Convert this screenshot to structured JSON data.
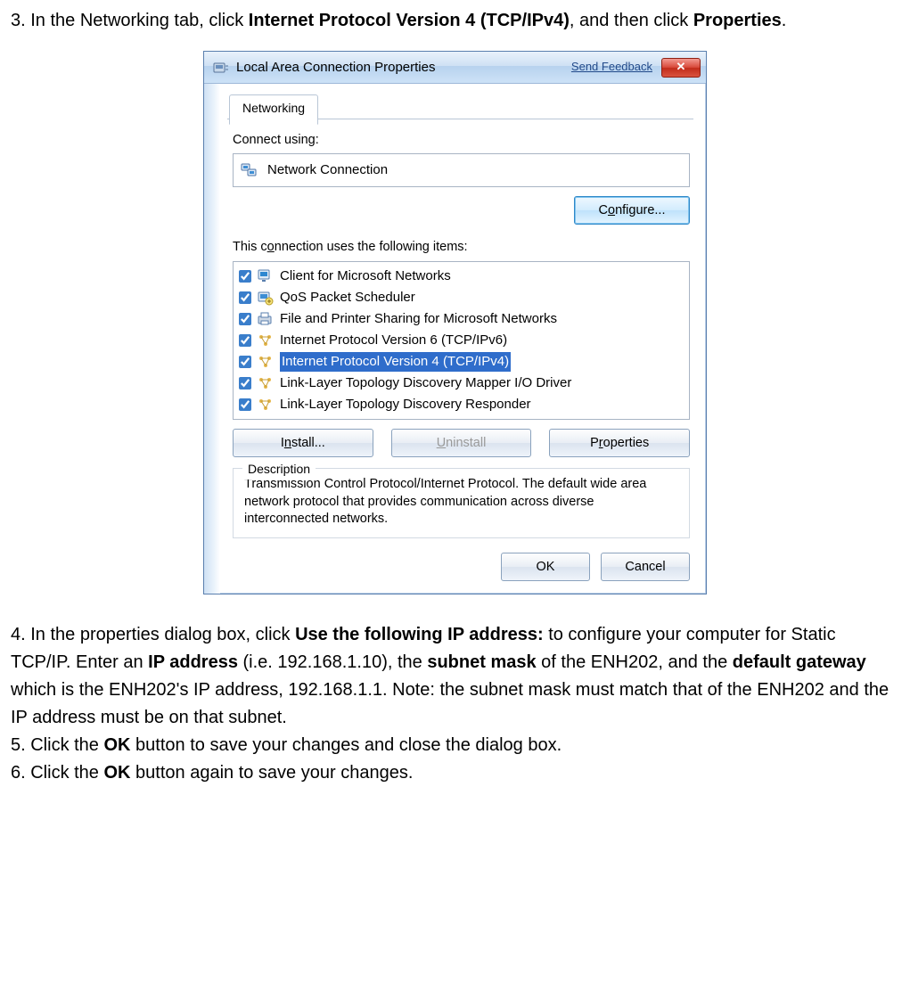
{
  "steps": {
    "s3_pre": "3.    In the Networking tab, click ",
    "s3_b1": "Internet Protocol Version 4 (TCP/IPv4)",
    "s3_mid": ", and then click ",
    "s3_b2": "Properties",
    "s3_post": ".",
    "s4_pre": "4.    In the properties dialog box, click ",
    "s4_b1": "Use the following IP address:",
    "s4_mid1": " to configure your computer for Static TCP/IP.    Enter an ",
    "s4_b2": "IP address",
    "s4_mid2": " (i.e. 192.168.1.10), the ",
    "s4_b3": "subnet mask",
    "s4_mid3": " of the ENH202, and the ",
    "s4_b4": "default gateway",
    "s4_mid4": " which is the ENH202's IP address, 192.168.1.1.    Note: the subnet mask must match that of the ENH202 and the IP address must be on that subnet.",
    "s5_pre": "5.    Click the ",
    "s5_b1": "OK",
    "s5_post": " button to save your changes and close the dialog box.",
    "s6_pre": "6.    Click the ",
    "s6_b1": "OK",
    "s6_post": " button again to save your changes."
  },
  "dialog": {
    "title": "Local Area Connection Properties",
    "feedback": "Send Feedback",
    "close_glyph": "✕",
    "tab": "Networking",
    "connect_using_label": "Connect using:",
    "connection_name": "Network Connection",
    "configure_btn_pre": "C",
    "configure_btn_u": "o",
    "configure_btn_post": "nfigure...",
    "items_label_pre": "This c",
    "items_label_u": "o",
    "items_label_post": "nnection uses the following items:",
    "items": [
      {
        "label": "Client for Microsoft Networks",
        "icon": "client",
        "selected": false
      },
      {
        "label": "QoS Packet Scheduler",
        "icon": "qos",
        "selected": false
      },
      {
        "label": "File and Printer Sharing for Microsoft Networks",
        "icon": "share",
        "selected": false
      },
      {
        "label": "Internet Protocol Version 6 (TCP/IPv6)",
        "icon": "proto",
        "selected": false
      },
      {
        "label": "Internet Protocol Version 4 (TCP/IPv4)",
        "icon": "proto",
        "selected": true
      },
      {
        "label": "Link-Layer Topology Discovery Mapper I/O Driver",
        "icon": "proto",
        "selected": false
      },
      {
        "label": "Link-Layer Topology Discovery Responder",
        "icon": "proto",
        "selected": false
      }
    ],
    "install_pre": "I",
    "install_u": "n",
    "install_post": "stall...",
    "uninstall_pre": "",
    "uninstall_u": "U",
    "uninstall_post": "ninstall",
    "properties_pre": "P",
    "properties_u": "r",
    "properties_post": "operties",
    "desc_title": "Description",
    "desc_text": "Transmission Control Protocol/Internet Protocol. The default wide area network protocol that provides communication across diverse interconnected networks.",
    "ok": "OK",
    "cancel": "Cancel"
  }
}
